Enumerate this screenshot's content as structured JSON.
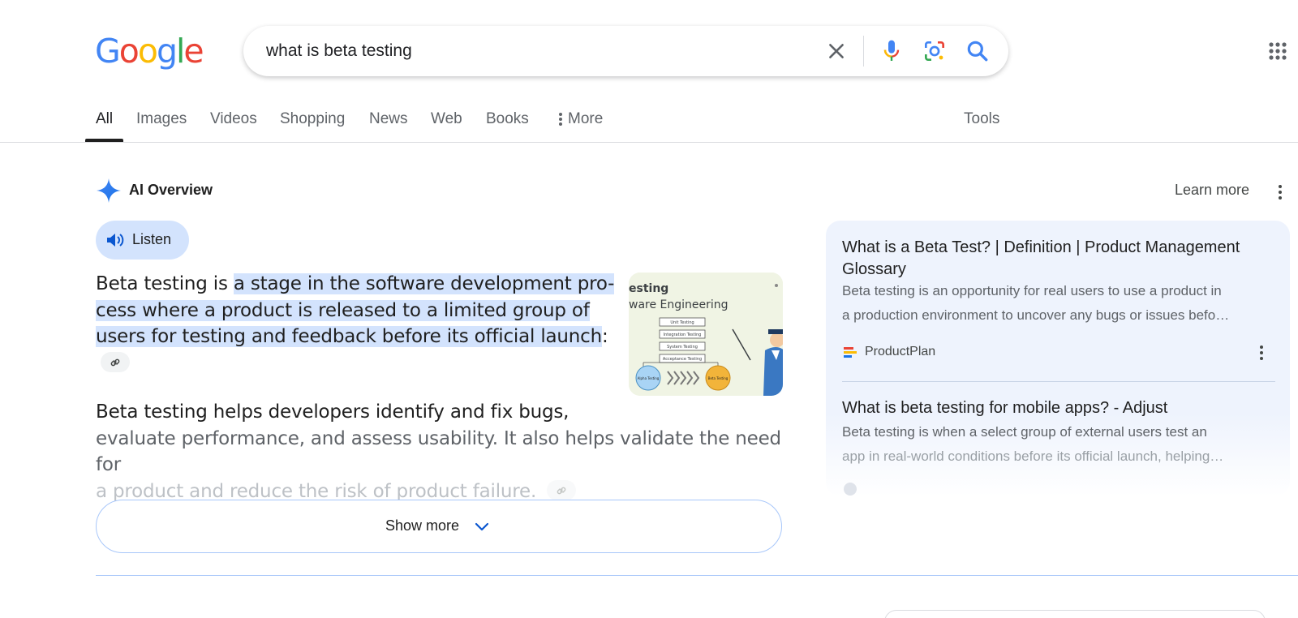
{
  "header": {
    "logo_letters": [
      {
        "ch": "G",
        "color": "#4285F4"
      },
      {
        "ch": "o",
        "color": "#EA4335"
      },
      {
        "ch": "o",
        "color": "#FBBC05"
      },
      {
        "ch": "g",
        "color": "#4285F4"
      },
      {
        "ch": "l",
        "color": "#34A853"
      },
      {
        "ch": "e",
        "color": "#EA4335"
      }
    ],
    "search_value": "what is beta testing"
  },
  "tabs": [
    {
      "label": "All"
    },
    {
      "label": "Images"
    },
    {
      "label": "Videos"
    },
    {
      "label": "Shopping"
    },
    {
      "label": "News"
    },
    {
      "label": "Web"
    },
    {
      "label": "Books"
    },
    {
      "label": "More"
    },
    {
      "label": "Tools"
    }
  ],
  "ai_overview": {
    "title": "AI Overview",
    "learn_more": "Learn more",
    "listen_label": "Listen",
    "para1_lead": "Beta testing is ",
    "para1_highlight": "a stage in the software development pro-cess where a product is released to a limited group of users for testing and feedback before its official launch",
    "para1_tail": ":",
    "para2_a": "Beta testing helps developers identify and fix bugs,",
    "para2_b": "evaluate performance, and assess usability. It also helps validate the need for",
    "para2_c": "a product and reduce the risk of product failure.",
    "show_more": "Show more",
    "thumb": {
      "title1": "esting",
      "title2": "ware Engineering",
      "boxes": [
        "Unit Testing",
        "Integration Testing",
        "System Testing",
        "Acceptance Testing"
      ],
      "circle_left": "Alpha Testing",
      "circle_right": "Beta Testing"
    }
  },
  "sources": [
    {
      "title": "What is a Beta Test? | Definition | Product Management Glossary",
      "snippet_line1": "Beta testing is an opportunity for real users to use a product in",
      "snippet_line2": "a production environment to uncover any bugs or issues befo…",
      "site": "ProductPlan"
    },
    {
      "title": "What is beta testing for mobile apps? - Adjust",
      "snippet_line1": "Beta testing is when a select group of external users test an",
      "snippet_line2": "app in real-world conditions before its official launch, helping…"
    }
  ],
  "colors": {
    "accent_blue": "#1a73e8",
    "highlight": "#d3e3fd",
    "panel_bg": "#eef3fd"
  }
}
